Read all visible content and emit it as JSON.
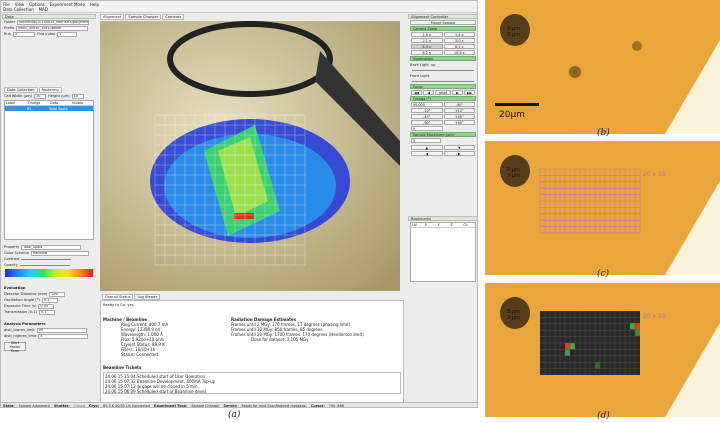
{
  "menubar": {
    "items": [
      "File",
      "View",
      "Options",
      "Experiment Mode",
      "Help"
    ]
  },
  "submenubar": {
    "items": [
      "Data Collection",
      "MAD"
    ]
  },
  "left": {
    "data_title": "Data",
    "folder_label": "Folder",
    "folder_value": "/beamline/20150624_MorrisMX/polymerase1",
    "prefix_label": "Prefix",
    "prefix_value": "lyso1_30x30_10x10beam",
    "run_label": "Run",
    "run_value": "3",
    "find_index_label": "Find index",
    "find_index_value": "1",
    "dc_title": "Data Collection",
    "raster_tab": "Rastering",
    "cell_width_label": "Cell Width (µm)",
    "cell_width_value": "10",
    "height_label": "Height (µm)",
    "height_value": "10",
    "table_headers": [
      "Label",
      "Omega",
      "Data",
      "Visible"
    ],
    "table_row": [
      "",
      "91",
      "Total Spots",
      ""
    ],
    "property_label": "Property",
    "property_value": "Total_Spots",
    "scheme_label": "Color Scheme",
    "scheme_value": "Rainbow",
    "contrast_label": "Contrast",
    "opacity_label": "Opacity",
    "evaluation_title": "Evaluation",
    "detector_label": "Detector Distance (mm)",
    "detector_value": "200",
    "oscillation_label": "Oscillation Angle (°)",
    "oscillation_value": "0.1",
    "exposure_label": "Exposure Time (s)",
    "exposure_value": "0.04",
    "transmission_label": "Transmission (0-1)",
    "transmission_value": "0.1",
    "analysis_title": "Analysis Parameters",
    "dist_low_label": "distl_lowres_limit",
    "dist_low_value": "50",
    "dist_high_label": "distl_highres_limit",
    "dist_high_value": "4",
    "start_raster_label": "Start Raster Scan"
  },
  "center": {
    "tabs": [
      "Alignment",
      "Sample Changer",
      "Cameras"
    ],
    "bottom_tabs": [
      "Overall Status",
      "Log Viewer"
    ],
    "ready_text": "Ready to Go: yes",
    "machine_title": "Machine / Beamline",
    "machine_rows": [
      "Ring Current: 400.7 mA",
      "Energy: 12398.9 eV",
      "Wavelength: 1.000 Å",
      "Flux: 5.920e+10 ph/s",
      "Cryojet Status: 89.9 K",
      "Fillers: 10/10+1h",
      "Status: Connected"
    ],
    "rad_title": "Radiation Damage Estimates",
    "rad_rows": [
      "Frames until 2 MGy: 170 frames, 17 degrees (phasing limit)",
      "Frames until 10 MGy: 850 frames, 85 degrees",
      "Frames until 20 MGy: 1700 frames, 170 degrees (Henderson limit)",
      "Dose for dataset: 2.105 MGy"
    ],
    "beamline_title": "Beamline Tickets",
    "log_rows": [
      "24.06.15 15:04 Scheduled start of User Operation",
      "24.06.15 07:32 Beamline Development, 400mA Top-up",
      "24.06.15 07:12 @ gaps will be closed in 5 min.",
      "24.06.15 06:39 Scheduled start of Beamline devel."
    ]
  },
  "right": {
    "align_title": "Alignment Controller",
    "mount_label": "Mount Sample",
    "unmount_label": "Unmount Sample",
    "camera_zoom_title": "Camera Zoom",
    "zoom_buttons": [
      "1.0 x",
      "1.4 x",
      "2.1 x",
      "3.0 x",
      "4.3 x",
      "6.2 x",
      "8.2 x",
      "10.9 x"
    ],
    "illumination_title": "Illumination",
    "back_light_label": "Back Light",
    "up_label": "up",
    "front_light_label": "Front Light",
    "focus_title": "Focus",
    "focus_buttons": [
      "◀◀",
      "◀",
      "reset",
      "▶",
      "▶▶"
    ],
    "omega_title": "Omega (°)",
    "omega_value": "90.000",
    "omega_buttons": [
      "-90°",
      "+90°",
      "-10°",
      "+10°",
      "-45°",
      "+45°",
      "-90°",
      "+90°"
    ],
    "omega_step": "5",
    "move_title": "Sample Movement (µm)",
    "move_value": "5",
    "bookmarks_title": "Bookmarks",
    "bookmark_headers": [
      "Lbl",
      "X",
      "Y",
      "Z",
      "Ch"
    ]
  },
  "statusbar": {
    "state_label": "State:",
    "state_value": "Sample Alignment",
    "shutter_label": "Shutter:",
    "shutter_value": "Closed",
    "cryo_label": "Cryo:",
    "cryo_value": "89.9 K 30/30 L/s Connected",
    "exp_label": "Experiment Type:",
    "exp_value": "Sample Changer",
    "server_label": "Server:",
    "server_value": "Ready for next ScanRequest message.",
    "cursor_label": "Cursor:",
    "cursor_value": "790, 886"
  },
  "figures": {
    "a": "(a)",
    "b": "(b)",
    "c": "(c)",
    "d": "(d)",
    "scale_b_top": "5 µm",
    "scale_b_bot": "3 µm",
    "scale_bar": "20µm",
    "grid_label": "20 x 10",
    "scale_c_top": "5 µm",
    "scale_c_bot": "3 µm",
    "scale_d_top": "5 µm",
    "scale_d_bot": "3 µm"
  }
}
